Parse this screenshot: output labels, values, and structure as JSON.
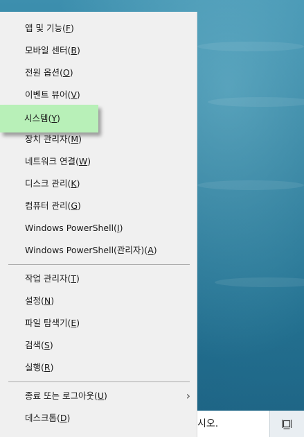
{
  "menu": {
    "items": [
      {
        "label": "앱 및 기능(",
        "key": "F",
        "suffix": ")"
      },
      {
        "label": "모바일 센터(",
        "key": "B",
        "suffix": ")"
      },
      {
        "label": "전원 옵션(",
        "key": "O",
        "suffix": ")"
      },
      {
        "label": "이벤트 뷰어(",
        "key": "V",
        "suffix": ")"
      },
      {
        "label": "시스템(",
        "key": "Y",
        "suffix": ")"
      },
      {
        "label": "장치 관리자(",
        "key": "M",
        "suffix": ")"
      },
      {
        "label": "네트워크 연결(",
        "key": "W",
        "suffix": ")"
      },
      {
        "label": "디스크 관리(",
        "key": "K",
        "suffix": ")"
      },
      {
        "label": "컴퓨터 관리(",
        "key": "G",
        "suffix": ")"
      },
      {
        "label": "Windows PowerShell(",
        "key": "I",
        "suffix": ")"
      },
      {
        "label": "Windows PowerShell(관리자)(",
        "key": "A",
        "suffix": ")"
      },
      {
        "label": "작업 관리자(",
        "key": "T",
        "suffix": ")"
      },
      {
        "label": "설정(",
        "key": "N",
        "suffix": ")"
      },
      {
        "label": "파일 탐색기(",
        "key": "E",
        "suffix": ")"
      },
      {
        "label": "검색(",
        "key": "S",
        "suffix": ")"
      },
      {
        "label": "실행(",
        "key": "R",
        "suffix": ")"
      },
      {
        "label": "종료 또는 로그아웃(",
        "key": "U",
        "suffix": ")"
      },
      {
        "label": "데스크톱(",
        "key": "D",
        "suffix": ")"
      }
    ],
    "highlight_color": "#b8f0b8",
    "submenu_icon": "chevron-right-icon"
  },
  "taskbar": {
    "search_text": "시오.",
    "taskview_icon": "task-view-icon"
  }
}
